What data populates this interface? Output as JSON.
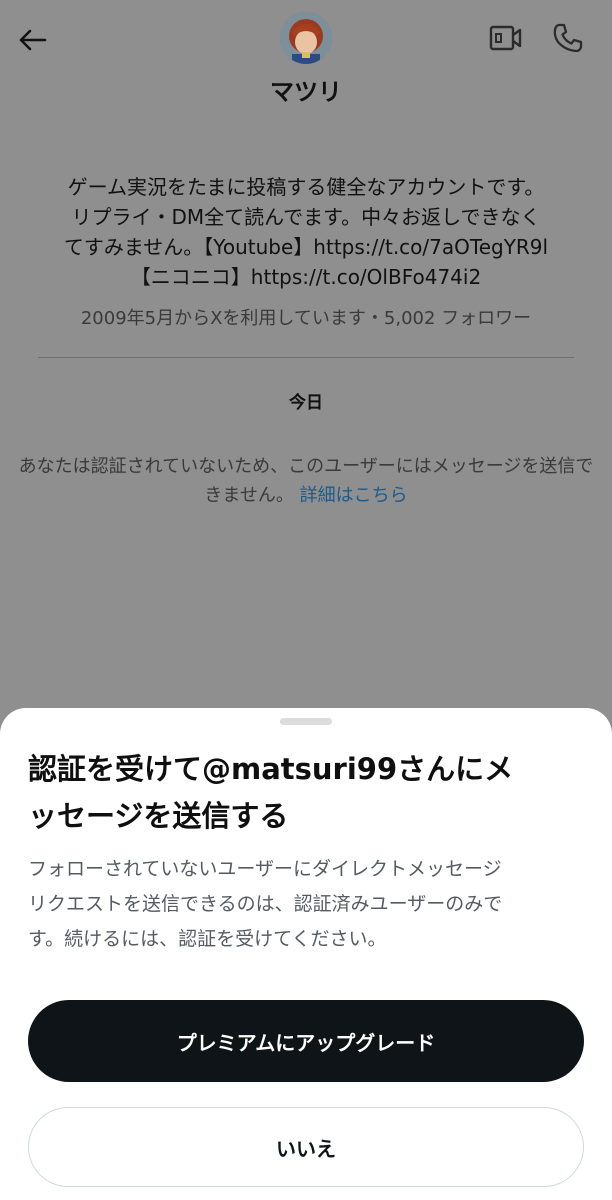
{
  "header": {
    "display_name": "マツリ",
    "back_icon": "arrow-left-icon",
    "video_icon": "video-camera-icon",
    "call_icon": "phone-icon"
  },
  "profile": {
    "bio_lines": [
      "ゲーム実況をたまに投稿する健全なアカウントです。",
      "リプライ・DM全て読んでます。中々お返しできなく",
      "てすみません。【Youtube】https://t.co/7aOTegYR9l",
      "【ニコニコ】https://t.co/OlBFo474i2"
    ],
    "meta": "2009年5月からXを利用しています・5,002 フォロワー"
  },
  "conversation": {
    "day_label": "今日",
    "notice_text": "あなたは認証されていないため、このユーザーにはメッセージを送信できません。",
    "notice_link": "詳細はこちら"
  },
  "sheet": {
    "title_lines": [
      "認証を受けて@matsuri99さんにメ",
      "ッセージを送信する"
    ],
    "body_lines": [
      "フォローされていないユーザーにダイレクトメッセージ",
      "リクエストを送信できるのは、認証済みユーザーのみで",
      "す。続けるには、認証を受けてください。"
    ],
    "primary_button": "プレミアムにアップグレード",
    "secondary_button": "いいえ"
  },
  "colors": {
    "overlay_background": "#8f8f8f",
    "primary_button": "#0f1419",
    "link": "#1a5c8e"
  }
}
